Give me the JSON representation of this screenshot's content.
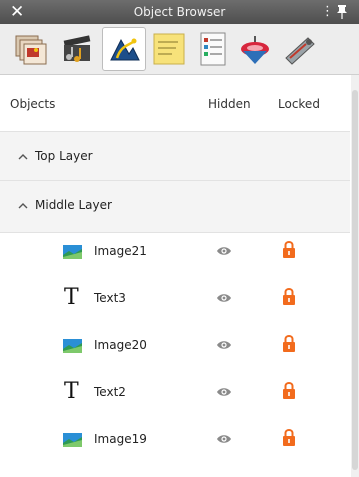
{
  "window": {
    "title": "Object Browser",
    "close_glyph": "✕",
    "menu_glyph": "⋮"
  },
  "toolbar": {
    "tools": [
      {
        "name": "pages-tool-icon",
        "active": false
      },
      {
        "name": "media-tool-icon",
        "active": false
      },
      {
        "name": "object-tool-icon",
        "active": true
      },
      {
        "name": "notes-tool-icon",
        "active": false
      },
      {
        "name": "properties-tool-icon",
        "active": false
      },
      {
        "name": "spinner-tool-icon",
        "active": false
      },
      {
        "name": "scanner-tool-icon",
        "active": false
      }
    ]
  },
  "columns": {
    "objects": "Objects",
    "hidden": "Hidden",
    "locked": "Locked"
  },
  "layers": [
    {
      "label": "Top Layer",
      "expanded": false
    },
    {
      "label": "Middle Layer",
      "expanded": true
    }
  ],
  "objects": [
    {
      "label": "Image21",
      "type": "image"
    },
    {
      "label": "Text3",
      "type": "text"
    },
    {
      "label": "Image20",
      "type": "image"
    },
    {
      "label": "Text2",
      "type": "text"
    },
    {
      "label": "Image19",
      "type": "image"
    }
  ],
  "colors": {
    "lock": "#f26b1d",
    "eye": "#8a8a8a",
    "titlebar": "#5a5a5a"
  }
}
